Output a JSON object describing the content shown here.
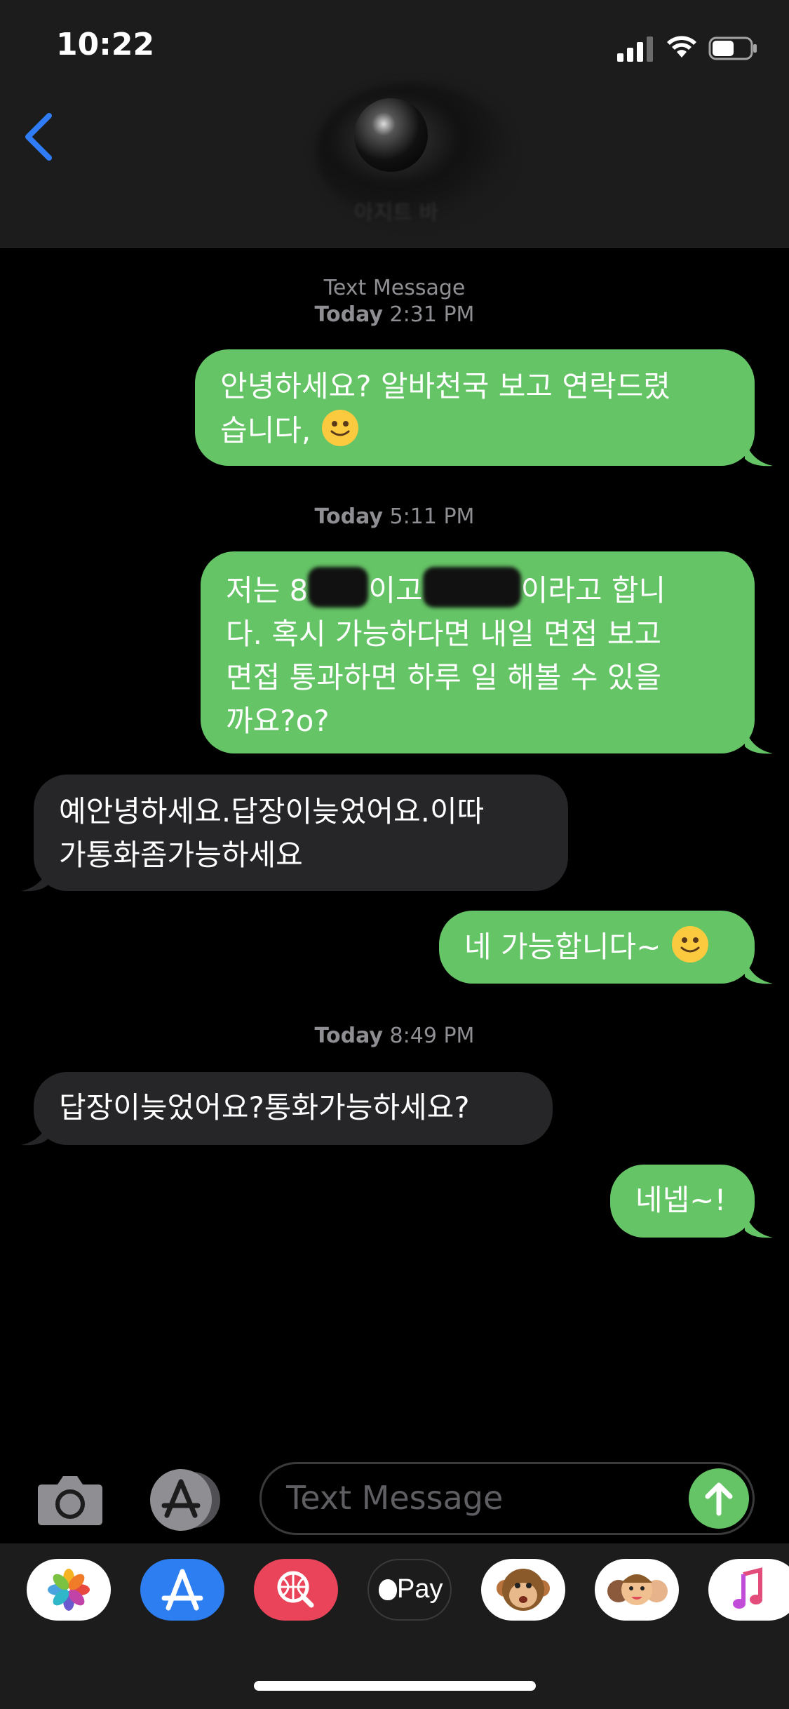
{
  "status_bar": {
    "time": "10:22"
  },
  "header": {
    "contact_name": "아지트 바"
  },
  "thread": {
    "group1": {
      "service": "Text Message",
      "day": "Today",
      "time": "2:31 PM"
    },
    "msg1": {
      "line1": "안녕하세요? 알바천국 보고 연락드렸",
      "line2": "습니다,"
    },
    "group2": {
      "day": "Today",
      "time": "5:11 PM"
    },
    "msg2": {
      "l1a": "저는 8",
      "l1b": "이고",
      "l1c": "이라고 합니",
      "line2": "다. 혹시 가능하다면 내일 면접 보고",
      "line3": "면접 통과하면 하루 일 해볼 수 있을",
      "line4": "까요?o?"
    },
    "msg3": {
      "line1": "예안녕하세요.답장이늦었어요.이따",
      "line2": "가통화좀가능하세요"
    },
    "msg4": {
      "text": "네 가능합니다~"
    },
    "group3": {
      "day": "Today",
      "time": "8:49 PM"
    },
    "msg5": {
      "text": "답장이늦었어요?통화가능하세요?"
    },
    "msg6": {
      "text": "네넵~!"
    }
  },
  "composer": {
    "placeholder": "Text Message"
  },
  "app_drawer": {
    "apple_pay_label": "Pay",
    "apps": [
      "photos-icon",
      "app-store-icon",
      "web-search-icon",
      "apple-pay-icon",
      "animoji-icon",
      "memoji-icon",
      "music-icon"
    ]
  },
  "colors": {
    "sent_bubble": "#65c466",
    "received_bubble": "#262629",
    "accent": "#2f7cf6"
  }
}
